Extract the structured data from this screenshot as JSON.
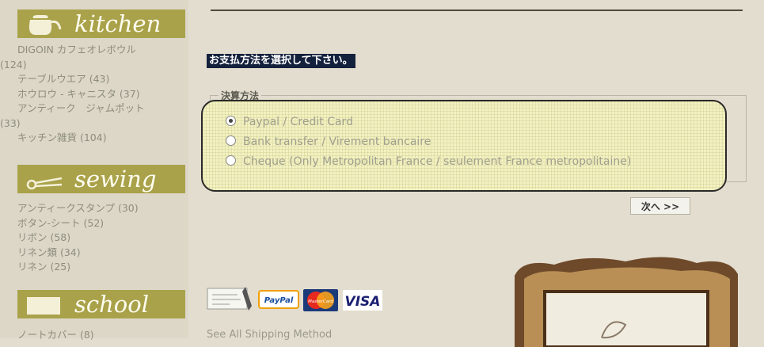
{
  "sidebar": {
    "kitchen": {
      "title": "kitchen",
      "icon": "kettle-icon",
      "items": [
        {
          "label": "DIGOIN カフェオレボウル",
          "count": "(124)"
        },
        {
          "label": "テーブルウエア (43)"
        },
        {
          "label": "ホウロウ - キャニスタ (37)"
        },
        {
          "label": "アンティーク　ジャムポット",
          "count": "(33)"
        },
        {
          "label": "キッチン雑貨 (104)"
        }
      ]
    },
    "sewing": {
      "title": "sewing",
      "icon": "scissors-icon",
      "items": [
        {
          "label": "アンティークスタンプ (30)"
        },
        {
          "label": "ボタン-シート (52)"
        },
        {
          "label": "リボン (58)"
        },
        {
          "label": "リネン類 (34)"
        },
        {
          "label": "リネン (25)"
        }
      ]
    },
    "school": {
      "title": "school",
      "icon": "notebook-icon",
      "items": [
        {
          "label": "ノートカバー (8)"
        }
      ]
    }
  },
  "main": {
    "page_title": "お支払方法を選択して下さい。",
    "payment_fieldset": {
      "legend": "決算方法",
      "options": [
        {
          "label": "Paypal / Credit Card",
          "checked": true
        },
        {
          "label": "Bank transfer / Virement bancaire",
          "checked": false
        },
        {
          "label": "Cheque (Only Metropolitan France / seulement France metropolitaine)",
          "checked": false
        }
      ]
    },
    "next_button": "次へ >>",
    "payment_logos": [
      "cheque",
      "PayPal",
      "MasterCard",
      "VISA"
    ],
    "shipping_link": "See All Shipping Method",
    "accent_colors": {
      "olive": "#a9a24a",
      "title_bg": "#14213d",
      "highlight": "#f2f1c0"
    }
  }
}
